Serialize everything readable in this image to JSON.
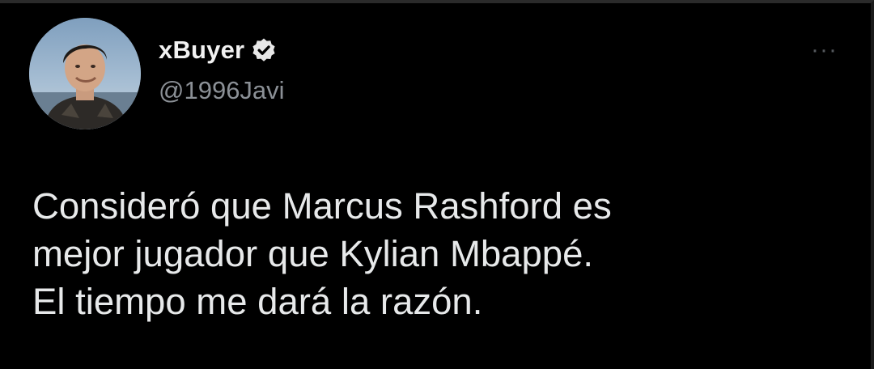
{
  "tweet": {
    "display_name": "xBuyer",
    "handle": "@1996Javi",
    "verified_icon": "verified-badge-icon",
    "more_icon": "more-options-icon",
    "more_glyph": "···",
    "text": "Consideró que Marcus Rashford es\nmejor jugador que Kylian Mbappé.\nEl tiempo me dará la razón."
  },
  "colors": {
    "background": "#000000",
    "name": "#f2f2f2",
    "handle": "#8b9096",
    "text": "#e7e9ea"
  }
}
